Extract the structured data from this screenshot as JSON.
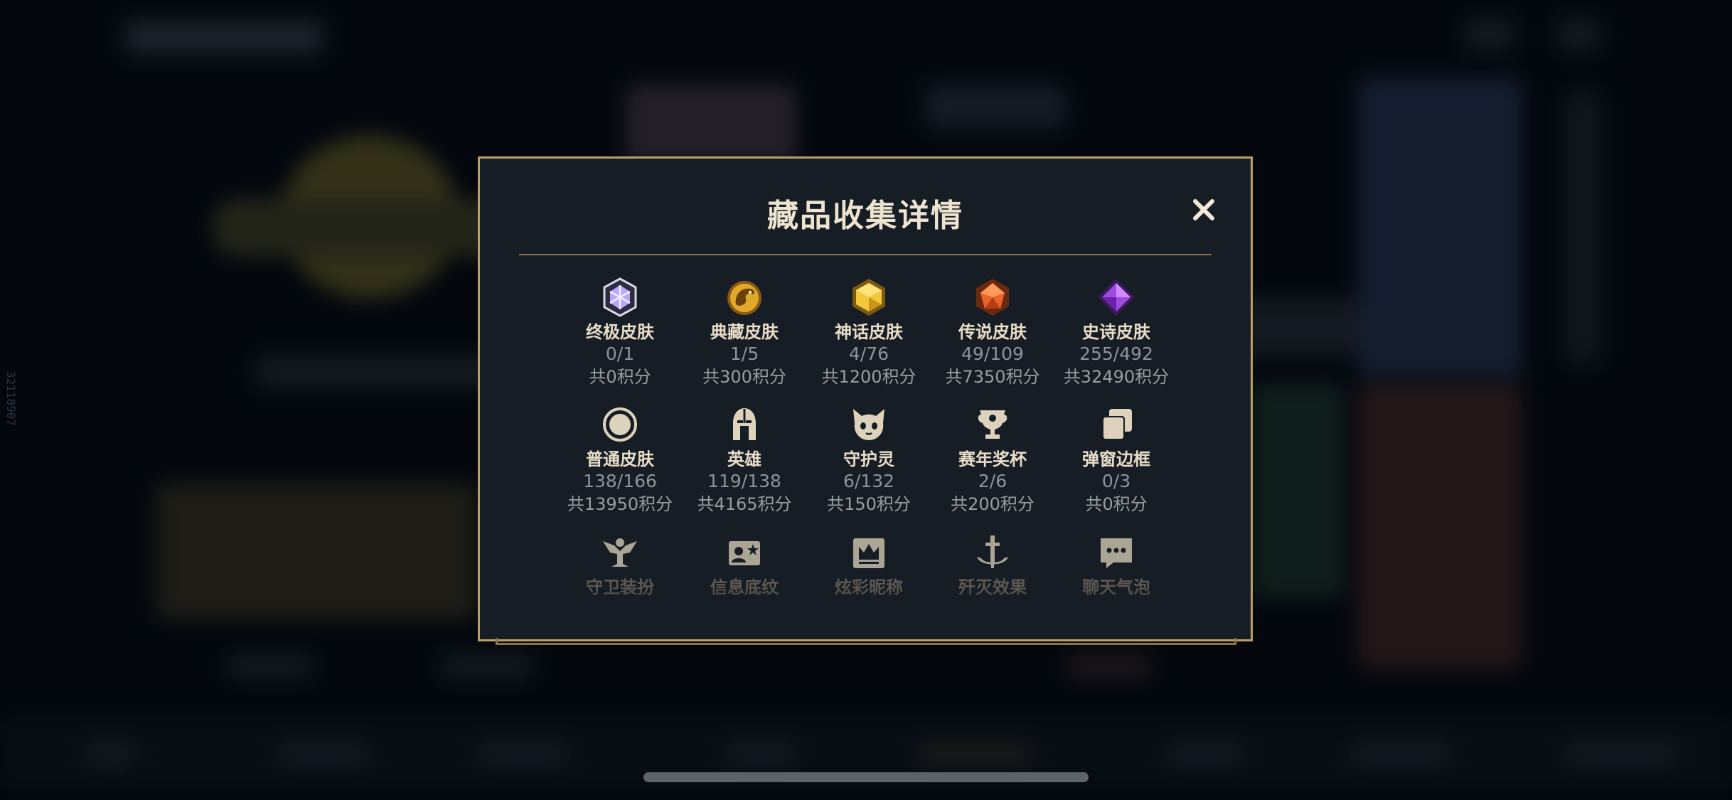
{
  "modal": {
    "title": "藏品收集详情",
    "close_symbol": "✕"
  },
  "categories": [
    {
      "icon": "ultimate-skin-gem-icon",
      "name": "终极皮肤",
      "count": "0/1",
      "points": "共0积分"
    },
    {
      "icon": "collection-skin-dragon-icon",
      "name": "典藏皮肤",
      "count": "1/5",
      "points": "共300积分"
    },
    {
      "icon": "mythic-skin-gem-icon",
      "name": "神话皮肤",
      "count": "4/76",
      "points": "共1200积分"
    },
    {
      "icon": "legendary-skin-gem-icon",
      "name": "传说皮肤",
      "count": "49/109",
      "points": "共7350积分"
    },
    {
      "icon": "epic-skin-gem-icon",
      "name": "史诗皮肤",
      "count": "255/492",
      "points": "共32490积分"
    },
    {
      "icon": "normal-skin-circle-icon",
      "name": "普通皮肤",
      "count": "138/166",
      "points": "共13950积分"
    },
    {
      "icon": "helmet-icon",
      "name": "英雄",
      "count": "119/138",
      "points": "共4165积分"
    },
    {
      "icon": "guardian-creature-icon",
      "name": "守护灵",
      "count": "6/132",
      "points": "共150积分"
    },
    {
      "icon": "trophy-icon",
      "name": "赛年奖杯",
      "count": "2/6",
      "points": "共200积分"
    },
    {
      "icon": "stacked-frames-icon",
      "name": "弹窗边框",
      "count": "0/3",
      "points": "共0积分"
    },
    {
      "icon": "ward-icon",
      "name": "守卫装扮"
    },
    {
      "icon": "profile-card-icon",
      "name": "信息底纹"
    },
    {
      "icon": "crown-nameplate-icon",
      "name": "炫彩昵称"
    },
    {
      "icon": "anchor-sword-icon",
      "name": "歼灭效果"
    },
    {
      "icon": "chat-bubble-icon",
      "name": "聊天气泡"
    }
  ],
  "background": {
    "side_id": "32118907"
  },
  "colors": {
    "modal_border": "#bba064",
    "modal_bg": "#171d24",
    "title": "#ece3d0"
  }
}
